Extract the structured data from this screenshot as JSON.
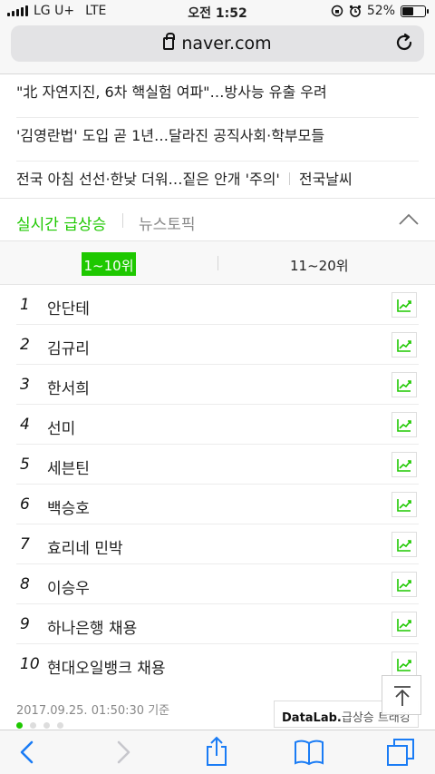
{
  "status_bar": {
    "carrier": "LG U+",
    "network": "LTE",
    "time": "오전 1:52",
    "battery_percent": "52%",
    "battery_level": 0.52
  },
  "browser": {
    "url": "naver.com"
  },
  "news": [
    {
      "text": "\"北 자연지진, 6차 핵실험 여파\"…방사능 유출 우려"
    },
    {
      "text": "'김영란법' 도입 곧 1년…달라진 공직사회·학부모들"
    },
    {
      "text": "전국 아침 선선·한낮 더워…짙은 안개 '주의'",
      "extra": "전국날씨"
    }
  ],
  "realtime": {
    "active_tab": "실시간 급상승",
    "tab_topic": "뉴스토픽",
    "range_1": "1~10위",
    "range_2": "11~20위",
    "ranks": [
      {
        "rank": "1",
        "keyword": "안단테"
      },
      {
        "rank": "2",
        "keyword": "김규리"
      },
      {
        "rank": "3",
        "keyword": "한서희"
      },
      {
        "rank": "4",
        "keyword": "선미"
      },
      {
        "rank": "5",
        "keyword": "세븐틴"
      },
      {
        "rank": "6",
        "keyword": "백승호"
      },
      {
        "rank": "7",
        "keyword": "효리네 민박"
      },
      {
        "rank": "8",
        "keyword": "이승우"
      },
      {
        "rank": "9",
        "keyword": "하나은행 채용"
      },
      {
        "rank": "10",
        "keyword": "현대오일뱅크 채용"
      }
    ],
    "timestamp": "2017.09.25. 01:50:30 기준",
    "datalab_brand": "DataLab.",
    "datalab_text": "급상승 트래킹"
  },
  "colors": {
    "accent": "#1ec800",
    "ios_blue": "#1a7cf5"
  }
}
